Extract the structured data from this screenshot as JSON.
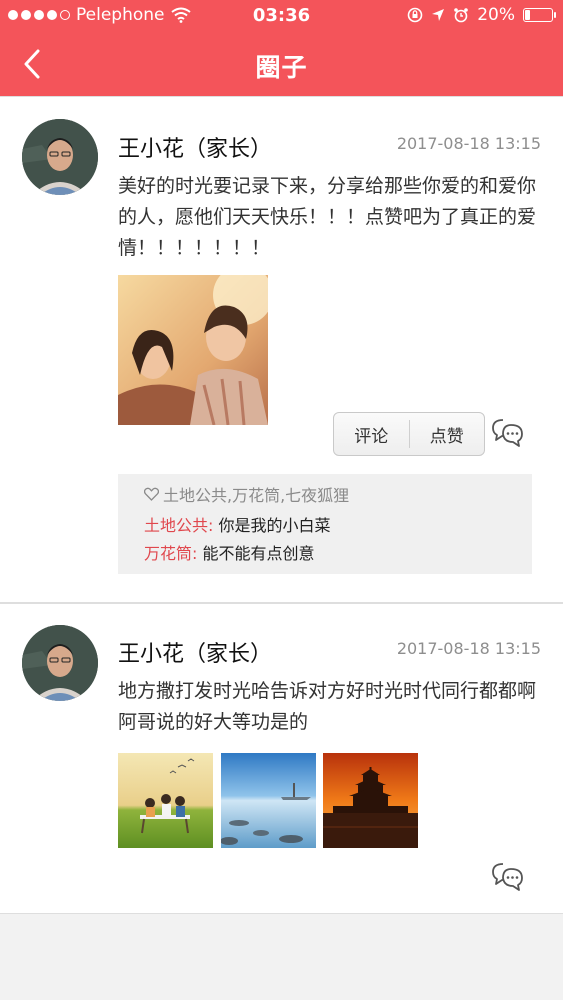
{
  "status_bar": {
    "carrier": "Pelephone",
    "time": "03:36",
    "battery": "20%",
    "battery_level": 0.2
  },
  "nav": {
    "title": "圈子"
  },
  "posts": [
    {
      "author": "王小花（家长）",
      "time": "2017-08-18  13:15",
      "text": "美好的时光要记录下来，分享给那些你爱的和爱你的人，愿他们天天快乐！！！点赞吧为了真正的爱情！！！！！！！",
      "actions": {
        "comment": "评论",
        "like": "点赞"
      },
      "likes": "土地公共,万花筒,七夜狐狸",
      "replies": [
        {
          "who": "土地公共:",
          "text": "你是我的小白菜"
        },
        {
          "who": "万花筒:",
          "text": "能不能有点创意"
        }
      ]
    },
    {
      "author": "王小花（家长）",
      "time": "2017-08-18  13:15",
      "text": "地方撒打发时光哈告诉对方好时光时代同行都都啊阿哥说的好大等功是的"
    }
  ]
}
